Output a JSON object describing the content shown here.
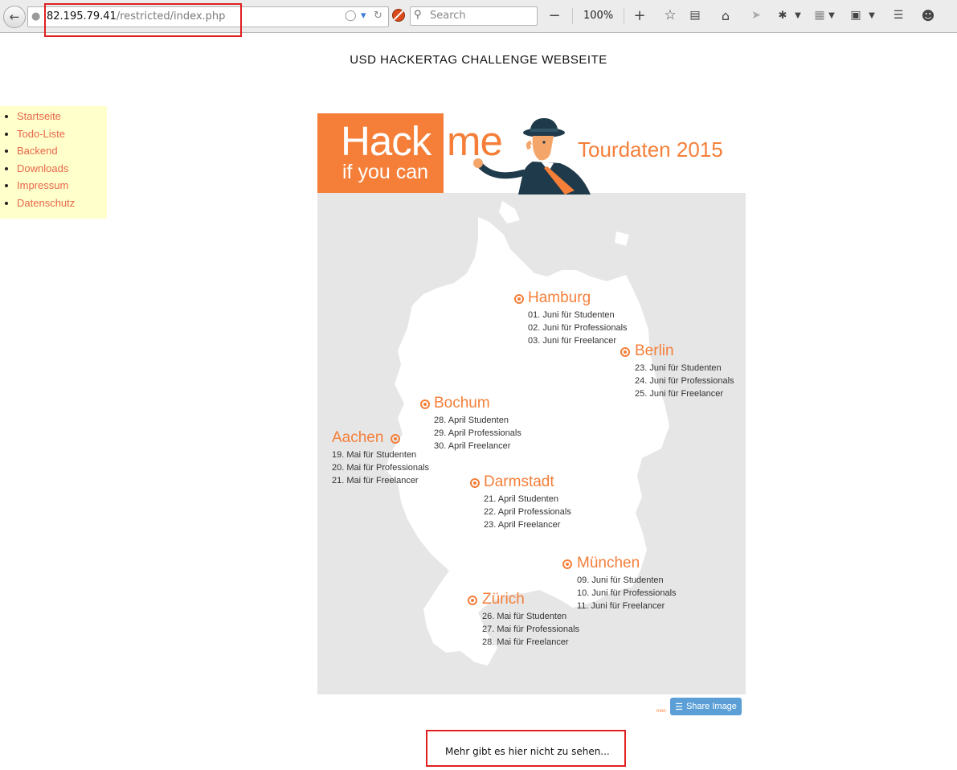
{
  "browser": {
    "url_host": "82.195.79.41",
    "url_path": "/restricted/index.php",
    "search_placeholder": "Search",
    "zoom": "100%",
    "icons": [
      "back-arrow-icon",
      "globe-icon",
      "pocket-icon",
      "dropdown-icon",
      "reload-icon",
      "adblock-icon",
      "search-icon",
      "zoom-out-icon",
      "zoom-in-icon",
      "bookmark-star-icon",
      "reading-list-icon",
      "home-icon",
      "send-icon",
      "bug-icon",
      "grid-icon",
      "pocket-save-icon",
      "layers-icon",
      "smiley-icon"
    ]
  },
  "site": {
    "title": "USD HACKERTAG CHALLENGE WEBSEITE"
  },
  "nav": {
    "items": [
      "Startseite",
      "Todo-Liste",
      "Backend",
      "Downloads",
      "Impressum",
      "Datenschutz"
    ]
  },
  "poster": {
    "hack": "Hack",
    "me": "me",
    "if_you_can": "if you can",
    "tour_title": "Tourdaten 2015",
    "cities": [
      {
        "name": "Hamburg",
        "lines": [
          "01. Juni für Studenten",
          "02. Juni für Professionals",
          "03. Juni für Freelancer"
        ]
      },
      {
        "name": "Berlin",
        "lines": [
          "23. Juni für Studenten",
          "24. Juni für Professionals",
          "25. Juni für Freelancer"
        ]
      },
      {
        "name": "Bochum",
        "lines": [
          "28. April Studenten",
          "29. April Professionals",
          "30. April Freelancer"
        ]
      },
      {
        "name": "Aachen",
        "lines": [
          "19. Mai für Studenten",
          "20. Mai für Professionals",
          "21. Mai für Freelancer"
        ]
      },
      {
        "name": "Darmstadt",
        "lines": [
          "21. April Studenten",
          "22. April Professionals",
          "23. April Freelancer"
        ]
      },
      {
        "name": "München",
        "lines": [
          "09. Juni für Studenten",
          "10. Juni für Professionals",
          "11. Juni für Freelancer"
        ]
      },
      {
        "name": "Zürich",
        "lines": [
          "26. Mai für Studenten",
          "27. Mai für Professionals",
          "28. Mai für Freelancer"
        ]
      }
    ],
    "share_label": "Share Image",
    "credit": "mon"
  },
  "footer": {
    "message": "Mehr gibt es hier nicht zu sehen..."
  },
  "colors": {
    "accent_orange": "#f57f39",
    "nav_bg": "#ffffcc",
    "nav_link": "#e8664a",
    "highlight_red": "#e0201f",
    "share_blue": "#5b9fd6"
  }
}
